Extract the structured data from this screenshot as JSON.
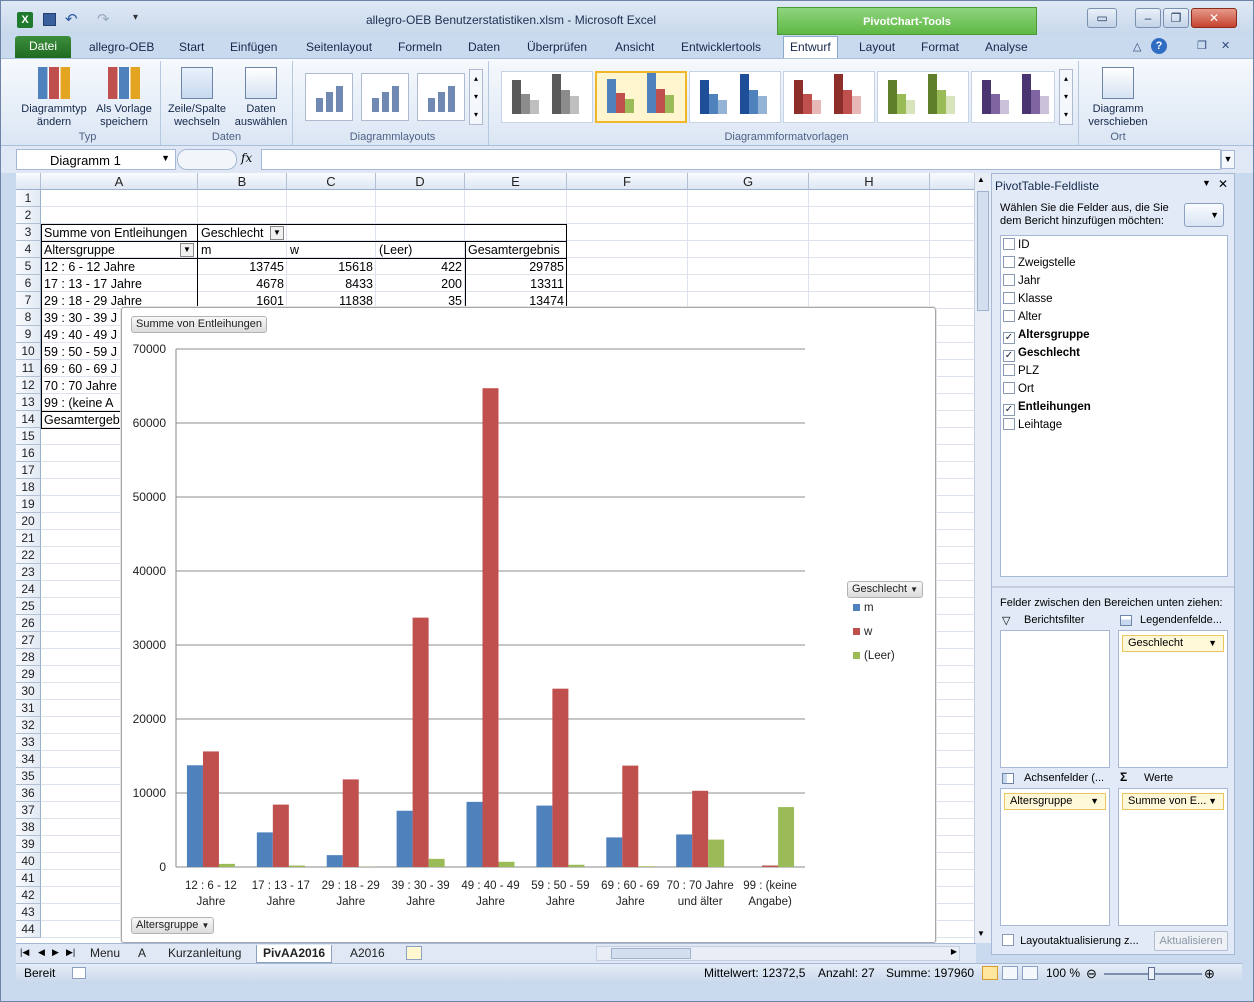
{
  "window": {
    "title": "allegro-OEB Benutzerstatistiken.xlsm - Microsoft Excel",
    "context_tab": "PivotChart-Tools"
  },
  "ribbon": {
    "tabs": [
      "Datei",
      "allegro-OEB",
      "Start",
      "Einfügen",
      "Seitenlayout",
      "Formeln",
      "Daten",
      "Überprüfen",
      "Ansicht",
      "Entwicklertools",
      "Entwurf",
      "Layout",
      "Format",
      "Analyse"
    ],
    "active_tab": "Entwurf",
    "groups": {
      "typ": {
        "label": "Typ",
        "btn1": "Diagrammtyp ändern",
        "btn2": "Als Vorlage speichern"
      },
      "daten": {
        "label": "Daten",
        "btn1": "Zeile/Spalte wechseln",
        "btn2": "Daten auswählen"
      },
      "layouts": {
        "label": "Diagrammlayouts"
      },
      "styles": {
        "label": "Diagrammformatvorlagen"
      },
      "ort": {
        "label": "Ort",
        "btn1": "Diagramm verschieben"
      }
    }
  },
  "formula_bar": {
    "name_box": "Diagramm 1",
    "fx": "fx",
    "value": ""
  },
  "sheet": {
    "columns": [
      "A",
      "B",
      "C",
      "D",
      "E",
      "F",
      "G",
      "H"
    ],
    "rows": [
      "1",
      "2",
      "3",
      "4",
      "5",
      "6",
      "7",
      "8",
      "9",
      "10",
      "11",
      "12",
      "13",
      "14",
      "15",
      "16",
      "17",
      "18",
      "19",
      "20",
      "21",
      "22",
      "23",
      "24",
      "25",
      "26",
      "27",
      "28",
      "29",
      "30",
      "31",
      "32",
      "33",
      "34",
      "35",
      "36",
      "37",
      "38",
      "39",
      "40",
      "41",
      "42",
      "43",
      "44"
    ],
    "pivot": {
      "r3a": "Summe von Entleihungen",
      "r3b": "Geschlecht",
      "r4a": "Altersgruppe",
      "r4b": "m",
      "r4c": "w",
      "r4d": "(Leer)",
      "r4e": "Gesamtergebnis",
      "r5": [
        "12 : 6 - 12 Jahre",
        "13745",
        "15618",
        "422",
        "29785"
      ],
      "r6": [
        "17 : 13 - 17 Jahre",
        "4678",
        "8433",
        "200",
        "13311"
      ],
      "r7": [
        "29 : 18 - 29 Jahre",
        "1601",
        "11838",
        "35",
        "13474"
      ],
      "r8": "39 : 30 - 39 J",
      "r9": "49 : 40 - 49 J",
      "r10": "59 : 50 - 59 J",
      "r11": "69 : 60 - 69 J",
      "r12": "70 : 70 Jahre",
      "r13": "99 : (keine A",
      "r14": "Gesamtergeb"
    }
  },
  "chart_data": {
    "type": "bar",
    "title": "",
    "value_field_button": "Summe von Entleihungen",
    "axis_field_button": "Altersgruppe",
    "legend_title": "Geschlecht",
    "legend_position": "right",
    "categories": [
      "12 : 6 - 12 Jahre",
      "17 : 13 - 17 Jahre",
      "29 : 18 - 29 Jahre",
      "39 : 30 - 39 Jahre",
      "49 : 40 - 49 Jahre",
      "59 : 50 - 59 Jahre",
      "69 : 60 - 69 Jahre",
      "70 : 70 Jahre und älter",
      "99 : (keine Angabe)"
    ],
    "category_lines": [
      [
        "12 : 6 - 12",
        "Jahre"
      ],
      [
        "17 : 13 - 17",
        "Jahre"
      ],
      [
        "29 : 18 - 29",
        "Jahre"
      ],
      [
        "39 : 30 - 39",
        "Jahre"
      ],
      [
        "49 : 40 - 49",
        "Jahre"
      ],
      [
        "59 : 50 - 59",
        "Jahre"
      ],
      [
        "69 : 60 - 69",
        "Jahre"
      ],
      [
        "70 : 70 Jahre",
        "und älter"
      ],
      [
        "99 : (keine",
        "Angabe)"
      ]
    ],
    "series": [
      {
        "name": "m",
        "color": "#4f81bd",
        "values": [
          13745,
          4678,
          1601,
          7600,
          8800,
          8300,
          4000,
          4400,
          0
        ]
      },
      {
        "name": "w",
        "color": "#c0504d",
        "values": [
          15618,
          8433,
          11838,
          33700,
          64700,
          24100,
          13700,
          10300,
          200
        ]
      },
      {
        "name": "(Leer)",
        "color": "#9bbb59",
        "values": [
          422,
          200,
          35,
          1100,
          700,
          300,
          100,
          3700,
          8100
        ]
      }
    ],
    "ylim": [
      0,
      70000
    ],
    "yticks": [
      "0",
      "10000",
      "20000",
      "30000",
      "40000",
      "50000",
      "60000",
      "70000"
    ],
    "grid": true
  },
  "sheet_tabs": [
    "Menu",
    "A",
    "Kurzanleitung",
    "PivAA2016",
    "A2016"
  ],
  "active_sheet": "PivAA2016",
  "status": {
    "ready": "Bereit",
    "average": "Mittelwert: 12372,5",
    "count": "Anzahl: 27",
    "sum": "Summe: 197960",
    "zoom": "100 %"
  },
  "field_pane": {
    "title": "PivotTable-Feldliste",
    "instruction": "Wählen Sie die Felder aus, die Sie dem Bericht hinzufügen möchten:",
    "fields": [
      {
        "label": "ID",
        "checked": false
      },
      {
        "label": "Zweigstelle",
        "checked": false
      },
      {
        "label": "Jahr",
        "checked": false
      },
      {
        "label": "Klasse",
        "checked": false
      },
      {
        "label": "Alter",
        "checked": false
      },
      {
        "label": "Altersgruppe",
        "checked": true
      },
      {
        "label": "Geschlecht",
        "checked": true
      },
      {
        "label": "PLZ",
        "checked": false
      },
      {
        "label": "Ort",
        "checked": false
      },
      {
        "label": "Entleihungen",
        "checked": true
      },
      {
        "label": "Leihtage",
        "checked": false
      }
    ],
    "drag_hint": "Felder zwischen den Bereichen unten ziehen:",
    "area_filter": "Berichtsfilter",
    "area_legend": "Legendenfelde...",
    "area_axis": "Achsenfelder (...",
    "area_values": "Werte",
    "chip_legend": "Geschlecht",
    "chip_axis": "Altersgruppe",
    "chip_values": "Summe von E...",
    "defer": "Layoutaktualisierung z...",
    "update": "Aktualisieren"
  }
}
